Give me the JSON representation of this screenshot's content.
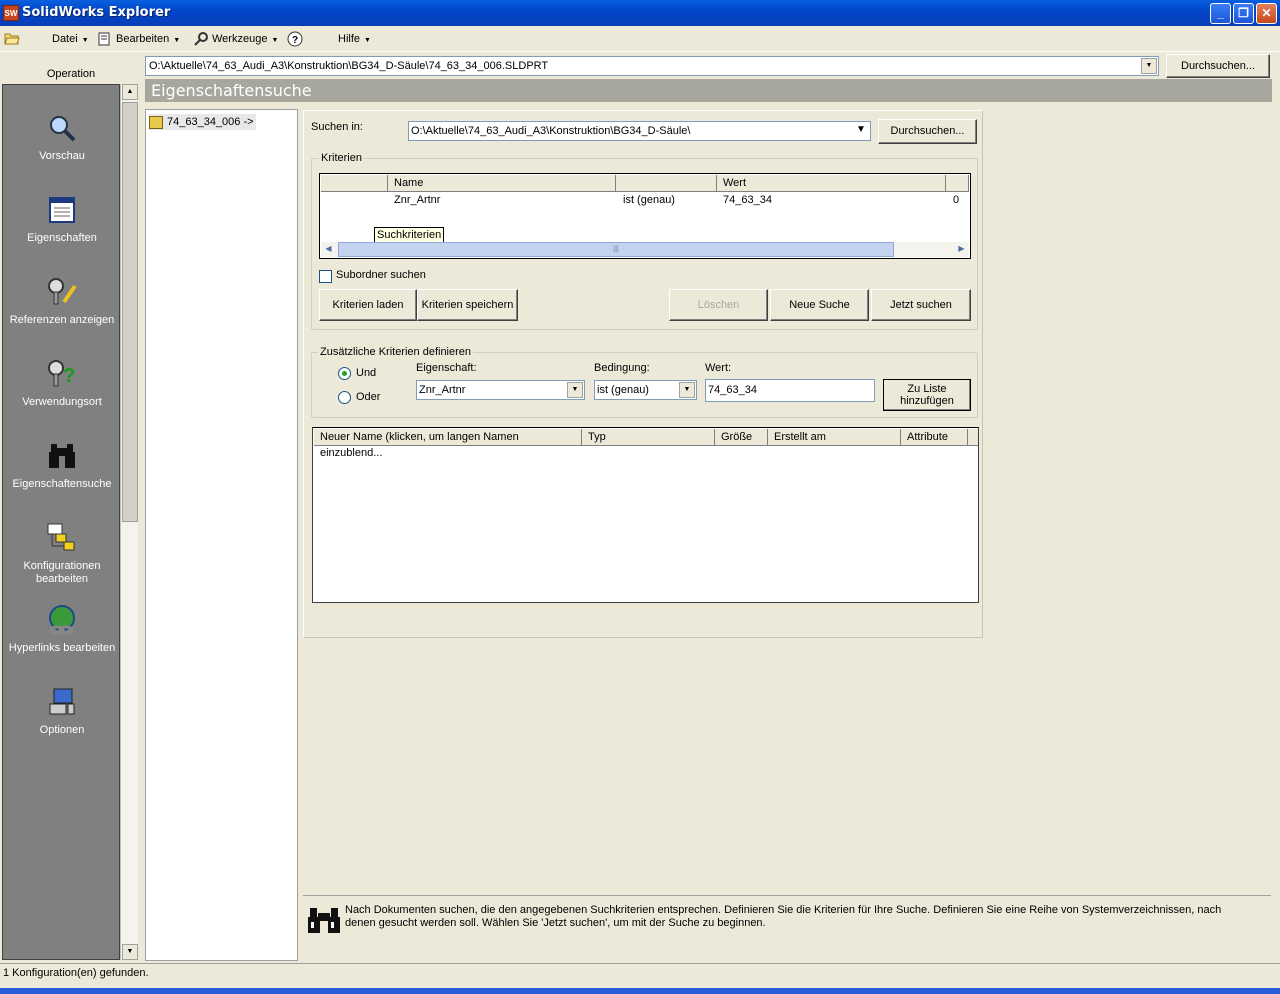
{
  "window": {
    "title": "SolidWorks Explorer",
    "app_icon": "SW"
  },
  "menu": [
    {
      "label": "Datei",
      "icon": "folder-icon"
    },
    {
      "label": "Bearbeiten",
      "icon": "edit-icon"
    },
    {
      "label": "Werkzeuge",
      "icon": "tools-icon"
    },
    {
      "label": "",
      "icon": "help-icon"
    },
    {
      "label": "Hilfe",
      "icon": ""
    }
  ],
  "operation_header": "Operation",
  "operations": [
    {
      "label": "Vorschau",
      "icon": "preview-icon"
    },
    {
      "label": "Eigenschaften",
      "icon": "properties-icon"
    },
    {
      "label": "Referenzen anzeigen",
      "icon": "references-icon"
    },
    {
      "label": "Verwendungsort",
      "icon": "where-used-icon"
    },
    {
      "label": "Eigenschaftensuche",
      "icon": "binoculars-icon"
    },
    {
      "label": "Konfigurationen bearbeiten",
      "icon": "configurations-icon"
    },
    {
      "label": "Hyperlinks bearbeiten",
      "icon": "hyperlinks-icon"
    },
    {
      "label": "Optionen",
      "icon": "options-icon"
    }
  ],
  "path": {
    "value": "O:\\Aktuelle\\74_63_Audi_A3\\Konstruktion\\BG34_D-Säule\\74_63_34_006.SLDPRT",
    "browse": "Durchsuchen..."
  },
  "header_title": "Eigenschaftensuche",
  "tree": {
    "node": "74_63_34_006 ->"
  },
  "search": {
    "in_label": "Suchen in:",
    "in_value": "O:\\Aktuelle\\74_63_Audi_A3\\Konstruktion\\BG34_D-Säule\\",
    "browse": "Durchsuchen..."
  },
  "criteria": {
    "group_title": "Kriterien",
    "columns": [
      "",
      "Name",
      "",
      "Wert",
      ""
    ],
    "rows": [
      {
        "c0": "",
        "name": "Znr_Artnr",
        "cond": "ist (genau)",
        "value": "74_63_34",
        "extra": "0"
      }
    ],
    "tooltip": "Suchkriterien",
    "subfolder_label": "Subordner suchen",
    "buttons": {
      "load": "Kriterien laden",
      "save": "Kriterien speichern",
      "delete": "Löschen",
      "new": "Neue Suche",
      "run": "Jetzt suchen"
    }
  },
  "additional": {
    "group_title": "Zusätzliche Kriterien definieren",
    "and_label": "Und",
    "or_label": "Oder",
    "property_label": "Eigenschaft:",
    "property_value": "Znr_Artnr",
    "condition_label": "Bedingung:",
    "condition_value": "ist (genau)",
    "value_label": "Wert:",
    "value_value": "74_63_34",
    "add_button_line1": "Zu Liste",
    "add_button_line2": "hinzufügen"
  },
  "results": {
    "columns": [
      "Neuer Name (klicken, um langen Namen einzublend...",
      "Typ",
      "Größe",
      "Erstellt am",
      "Attribute"
    ]
  },
  "help": {
    "text": "Nach Dokumenten suchen, die den angegebenen Suchkriterien entsprechen. Definieren Sie die Kriterien für Ihre Suche. Definieren Sie eine Reihe von Systemverzeichnissen, nach denen gesucht werden soll. Wählen Sie 'Jetzt suchen', um mit der Suche zu beginnen."
  },
  "status": "1 Konfiguration(en) gefunden."
}
